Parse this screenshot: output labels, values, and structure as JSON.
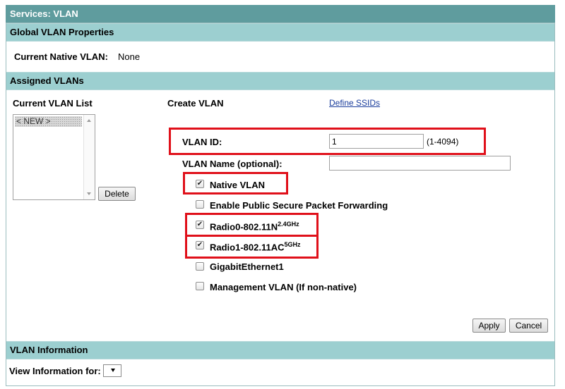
{
  "window": {
    "title": "Services: VLAN"
  },
  "global_props": {
    "header": "Global VLAN Properties",
    "native_label": "Current Native VLAN:",
    "native_value": "None"
  },
  "assigned": {
    "header": "Assigned VLANs",
    "list_label": "Current VLAN List",
    "list_items": [
      "< NEW >"
    ],
    "delete_label": "Delete",
    "create_label": "Create VLAN",
    "define_ssids": "Define SSIDs",
    "vlan_id_label": "VLAN ID:",
    "vlan_id_value": "1",
    "vlan_id_range": "(1-4094)",
    "vlan_name_label": "VLAN Name (optional):",
    "vlan_name_value": "",
    "options": {
      "native": {
        "label": "Native VLAN",
        "checked": true
      },
      "public_secure": {
        "label": "Enable Public Secure Packet Forwarding",
        "checked": false
      },
      "radio0": {
        "label": "Radio0-802.11N",
        "sup": "2.4GHz",
        "checked": true
      },
      "radio1": {
        "label": "Radio1-802.11AC",
        "sup": "5GHz",
        "checked": true
      },
      "gige": {
        "label": "GigabitEthernet1",
        "checked": false
      },
      "mgmt": {
        "label": "Management VLAN (If non-native)",
        "checked": false
      }
    },
    "apply_label": "Apply",
    "cancel_label": "Cancel"
  },
  "vlan_info": {
    "header": "VLAN Information",
    "view_label": "View Information for:",
    "view_selected": ""
  },
  "colors": {
    "titlebar": "#5f9c9e",
    "section": "#9ccfd0",
    "highlight": "#e0101a"
  }
}
